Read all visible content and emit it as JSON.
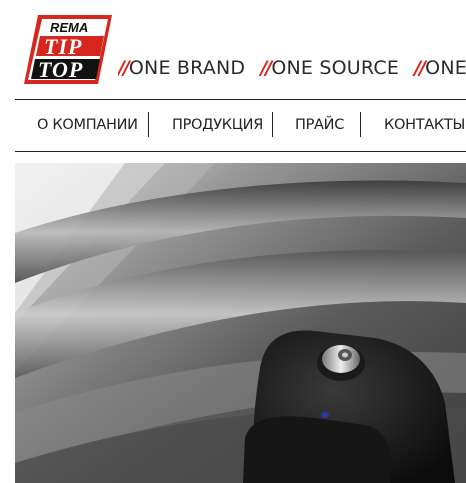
{
  "logo": {
    "top_word": "REMA",
    "line1": "TIP",
    "line2": "TOP",
    "brand_color": "#d7261e"
  },
  "tagline": {
    "separator": "//",
    "items": [
      "ONE BRAND",
      "ONE SOURCE",
      "ONE SY"
    ]
  },
  "nav": {
    "items": [
      {
        "label": "О КОМПАНИИ"
      },
      {
        "label": "ПРОДУКЦИЯ"
      },
      {
        "label": "ПРАЙС"
      },
      {
        "label": "КОНТАКТЫ"
      }
    ]
  },
  "hero": {
    "subject": "TPMS sensor mounted on wheel rim"
  }
}
